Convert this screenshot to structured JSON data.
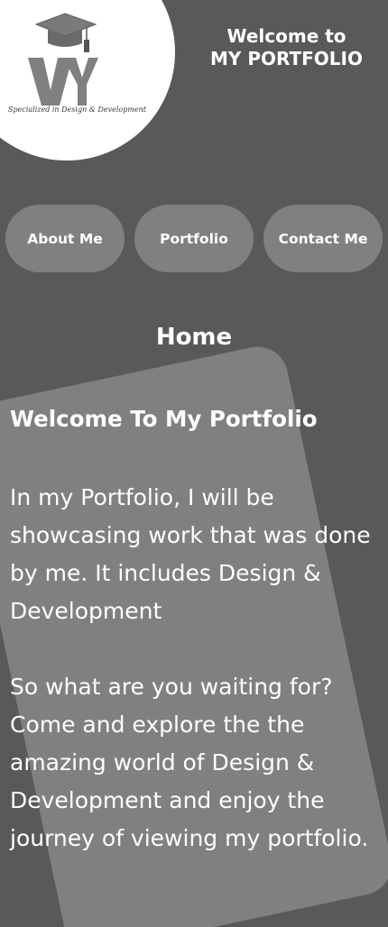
{
  "header": {
    "welcome_line1": "Welcome to",
    "welcome_line2": "MY PORTFOLIO",
    "logo": {
      "monogram": "VY",
      "tagline": "Specialized in Design & Development"
    }
  },
  "nav": {
    "items": [
      {
        "label": "About Me"
      },
      {
        "label": "Portfolio"
      },
      {
        "label": "Contact Me"
      }
    ]
  },
  "main": {
    "section_title": "Home",
    "heading": "Welcome To My Portfolio",
    "paragraph1": "In my Portfolio, I will be showcasing work that was done by me. It includes Design & Development",
    "paragraph2": "So what are you waiting for? Come and explore the the amazing world of Design & Development and enjoy the journey of viewing my portfolio."
  },
  "colors": {
    "background": "#595959",
    "card": "#808080",
    "button": "#808080",
    "text": "#ffffff",
    "logo_bg": "#ffffff",
    "logo_mark": "#808080"
  }
}
